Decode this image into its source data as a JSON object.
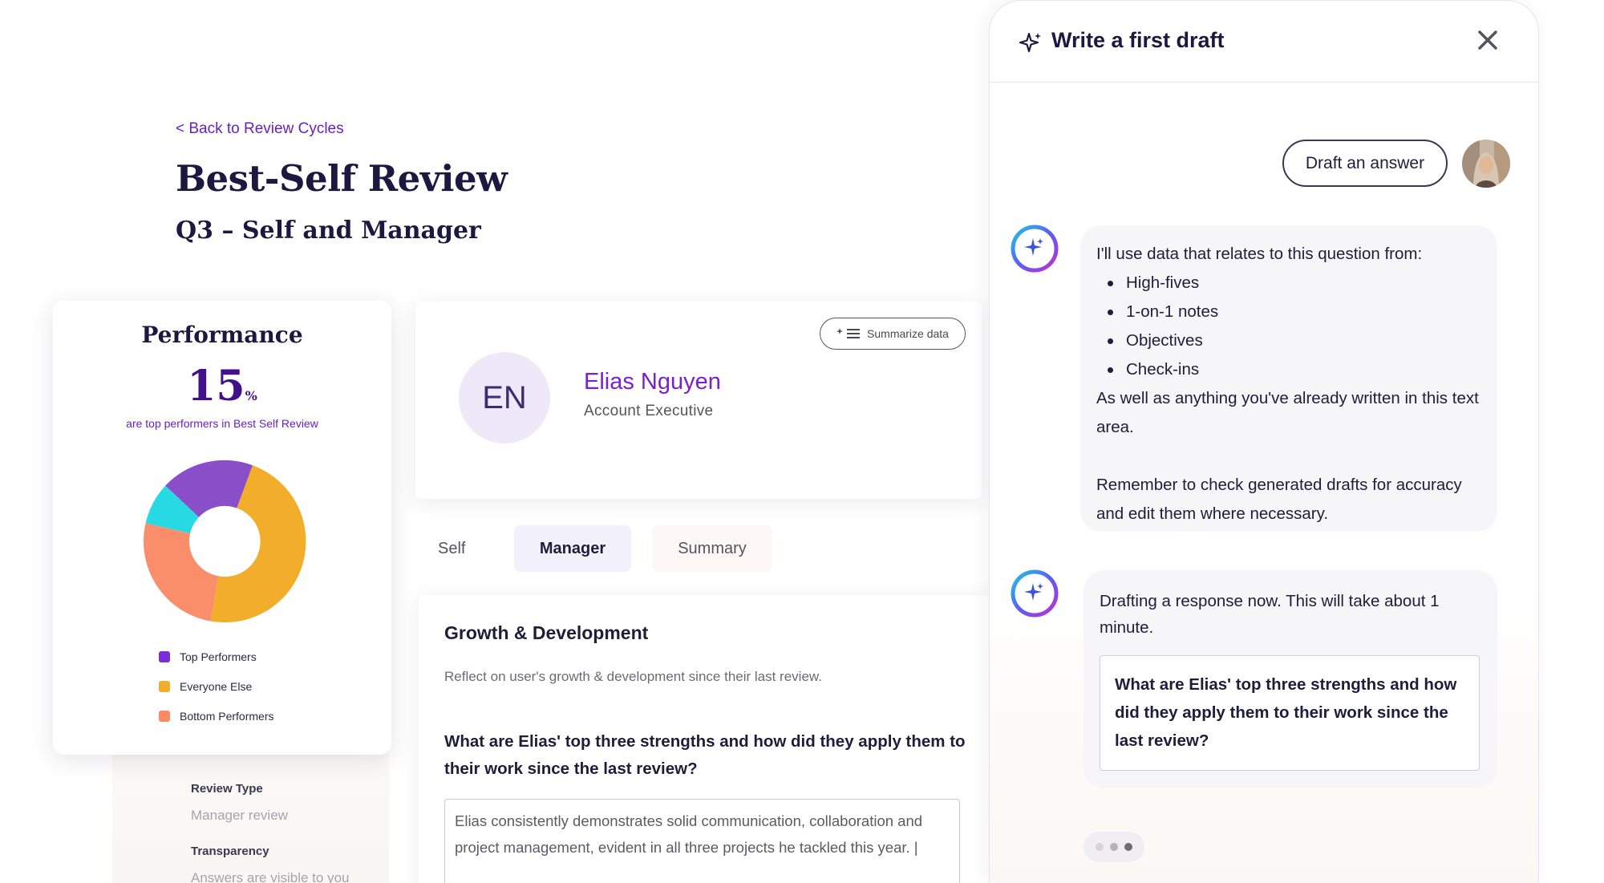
{
  "header": {
    "back_link": "< Back to Review Cycles",
    "title": "Best-Self Review",
    "subtitle": "Q3 – Self and Manager"
  },
  "performance": {
    "title": "Performance",
    "number": "15",
    "unit": "%",
    "caption": "are top performers in Best Self Review",
    "legend": [
      {
        "label": "Top Performers",
        "color": "#7b2ed6"
      },
      {
        "label": "Everyone Else",
        "color": "#f2ad2a"
      },
      {
        "label": "Bottom Performers",
        "color": "#fb8a64"
      }
    ],
    "donut_colors": {
      "purple": "#8a4fc8",
      "orange": "#f2ad2a",
      "salmon": "#fb8e6a",
      "teal": "#27d9e2"
    }
  },
  "employee": {
    "initials": "EN",
    "name": "Elias Nguyen",
    "role": "Account Executive",
    "summarize_label": "Summarize data"
  },
  "tabs": {
    "self": "Self",
    "manager": "Manager",
    "summary": "Summary"
  },
  "meta": {
    "review_type_label": "Review Type",
    "review_type_value": "Manager review",
    "transparency_label": "Transparency",
    "transparency_value": "Answers are visible to you"
  },
  "growth": {
    "title": "Growth & Development",
    "description": "Reflect on user's growth & development since their last review.",
    "question": "What are Elias' top three strengths and how did they apply them to their work since the last review?",
    "answer": "Elias consistently demonstrates solid communication, collaboration and project management, evident in all three projects he tackled this year. |"
  },
  "ai_panel": {
    "title": "Write a first draft",
    "user_prompt": "Draft an answer",
    "msg1_intro": "I'll use data that relates to this question from:",
    "msg1_items": [
      "High-fives",
      "1-on-1 notes",
      "Objectives",
      "Check-ins"
    ],
    "msg1_also": "As well as anything you've already written in this text area.",
    "msg1_reminder": "Remember to check generated drafts for accuracy and edit them where necessary.",
    "msg2_text": "Drafting a response now. This will take about 1 minute.",
    "msg2_quote": "What are Elias' top three strengths and how did they apply them to their work since the last review?"
  },
  "colors": {
    "accent": "#6a1fc4",
    "dark_text": "#1b1940"
  }
}
